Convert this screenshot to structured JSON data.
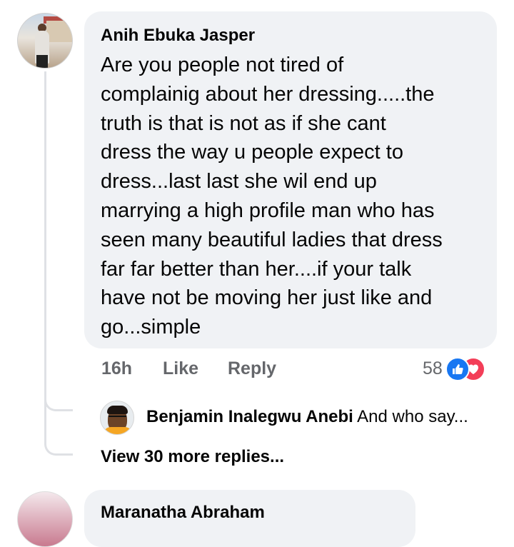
{
  "comment": {
    "author": "Anih Ebuka Jasper",
    "text": "Are you people not tired of\ncomplainig about her dressing.....the\ntruth is that is not as if she cant\ndress the way u people expect to\ndress...last last she wil end up\nmarrying a high profile man who has\nseen many beautiful ladies that dress\nfar far better than her....if your talk\nhave not be moving her just like and\ngo...simple",
    "time": "16h",
    "like_label": "Like",
    "reply_label": "Reply",
    "reaction_count": "58",
    "reaction_icons": [
      "like-icon",
      "love-icon"
    ],
    "colors": {
      "like": "#1877f2",
      "love": "#f33e58"
    }
  },
  "reply": {
    "author": "Benjamin Inalegwu Anebi",
    "snippet": "And who say..."
  },
  "view_more_label": "View 30 more replies...",
  "next_comment": {
    "author": "Maranatha Abraham"
  }
}
